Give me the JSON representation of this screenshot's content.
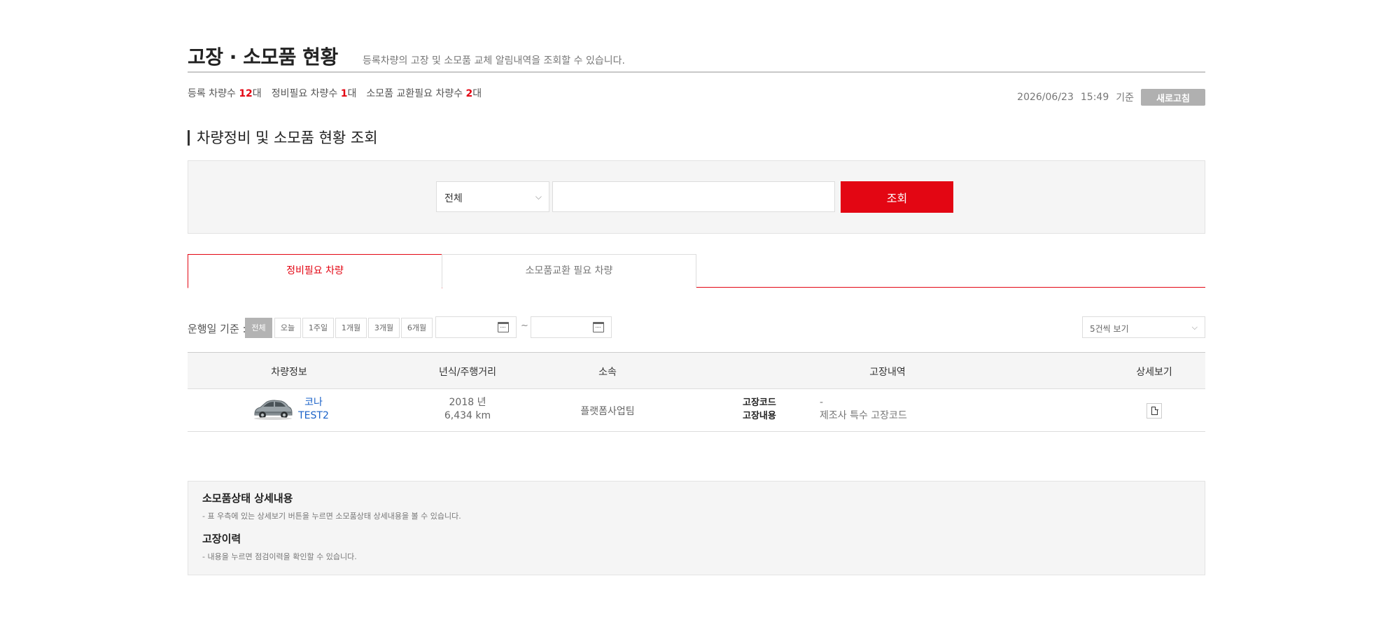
{
  "header": {
    "title": "고장 · 소모품 현황",
    "subtitle": "등록차량의 고장 및 소모품 교체 알림내역을 조회할 수 있습니다."
  },
  "stats": {
    "registered_label": "등록 차량수 ",
    "registered_value": "12",
    "registered_unit": "대",
    "maintenance_label": "정비필요 차량수 ",
    "maintenance_value": "1",
    "maintenance_unit": "대",
    "consumable_label": "소모품 교환필요 차량수 ",
    "consumable_value": "2",
    "consumable_unit": "대"
  },
  "timestamp": {
    "date": "2026/06/23",
    "time": "15:49",
    "suffix": "기준",
    "refresh_label": "새로고침"
  },
  "search": {
    "section_title": "차량정비 및 소모품 현황 조회",
    "filter_selected": "전체",
    "query_value": "",
    "button_label": "조회"
  },
  "tabs": [
    {
      "label": "정비필요 차량",
      "active": true
    },
    {
      "label": "소모품교환 필요 차량",
      "active": false
    }
  ],
  "filter": {
    "label": "운행일 기준 :",
    "periods": [
      "전체",
      "오늘",
      "1주일",
      "1개월",
      "3개월",
      "6개월"
    ],
    "active_period": "전체",
    "date_from": "",
    "date_to": "",
    "range_sep": "~",
    "per_page": "5건씩 보기"
  },
  "table": {
    "headers": [
      "차량정보",
      "년식/주행거리",
      "소속",
      "고장내역",
      "상세보기"
    ],
    "rows": [
      {
        "car_model": "코나",
        "car_plate": "TEST2",
        "year": "2018 년",
        "mileage": "6,434 km",
        "org": "플랫폼사업팀",
        "fault_code_label": "고장코드",
        "fault_code": "-",
        "fault_desc_label": "고장내용",
        "fault_desc": "제조사 특수 고장코드"
      }
    ]
  },
  "info": {
    "heading1": "소모품상태 상세내용",
    "text1": "- 표 우측에 있는 상세보기 버튼을 누르면 소모품상태 상세내용을 볼 수 있습니다.",
    "heading2": "고장이력",
    "text2": "- 내용을 누르면 점검이력을 확인할 수 있습니다."
  },
  "colors": {
    "accent": "#e30613",
    "link": "#1a62c8",
    "muted_button": "#b0b0b0"
  }
}
